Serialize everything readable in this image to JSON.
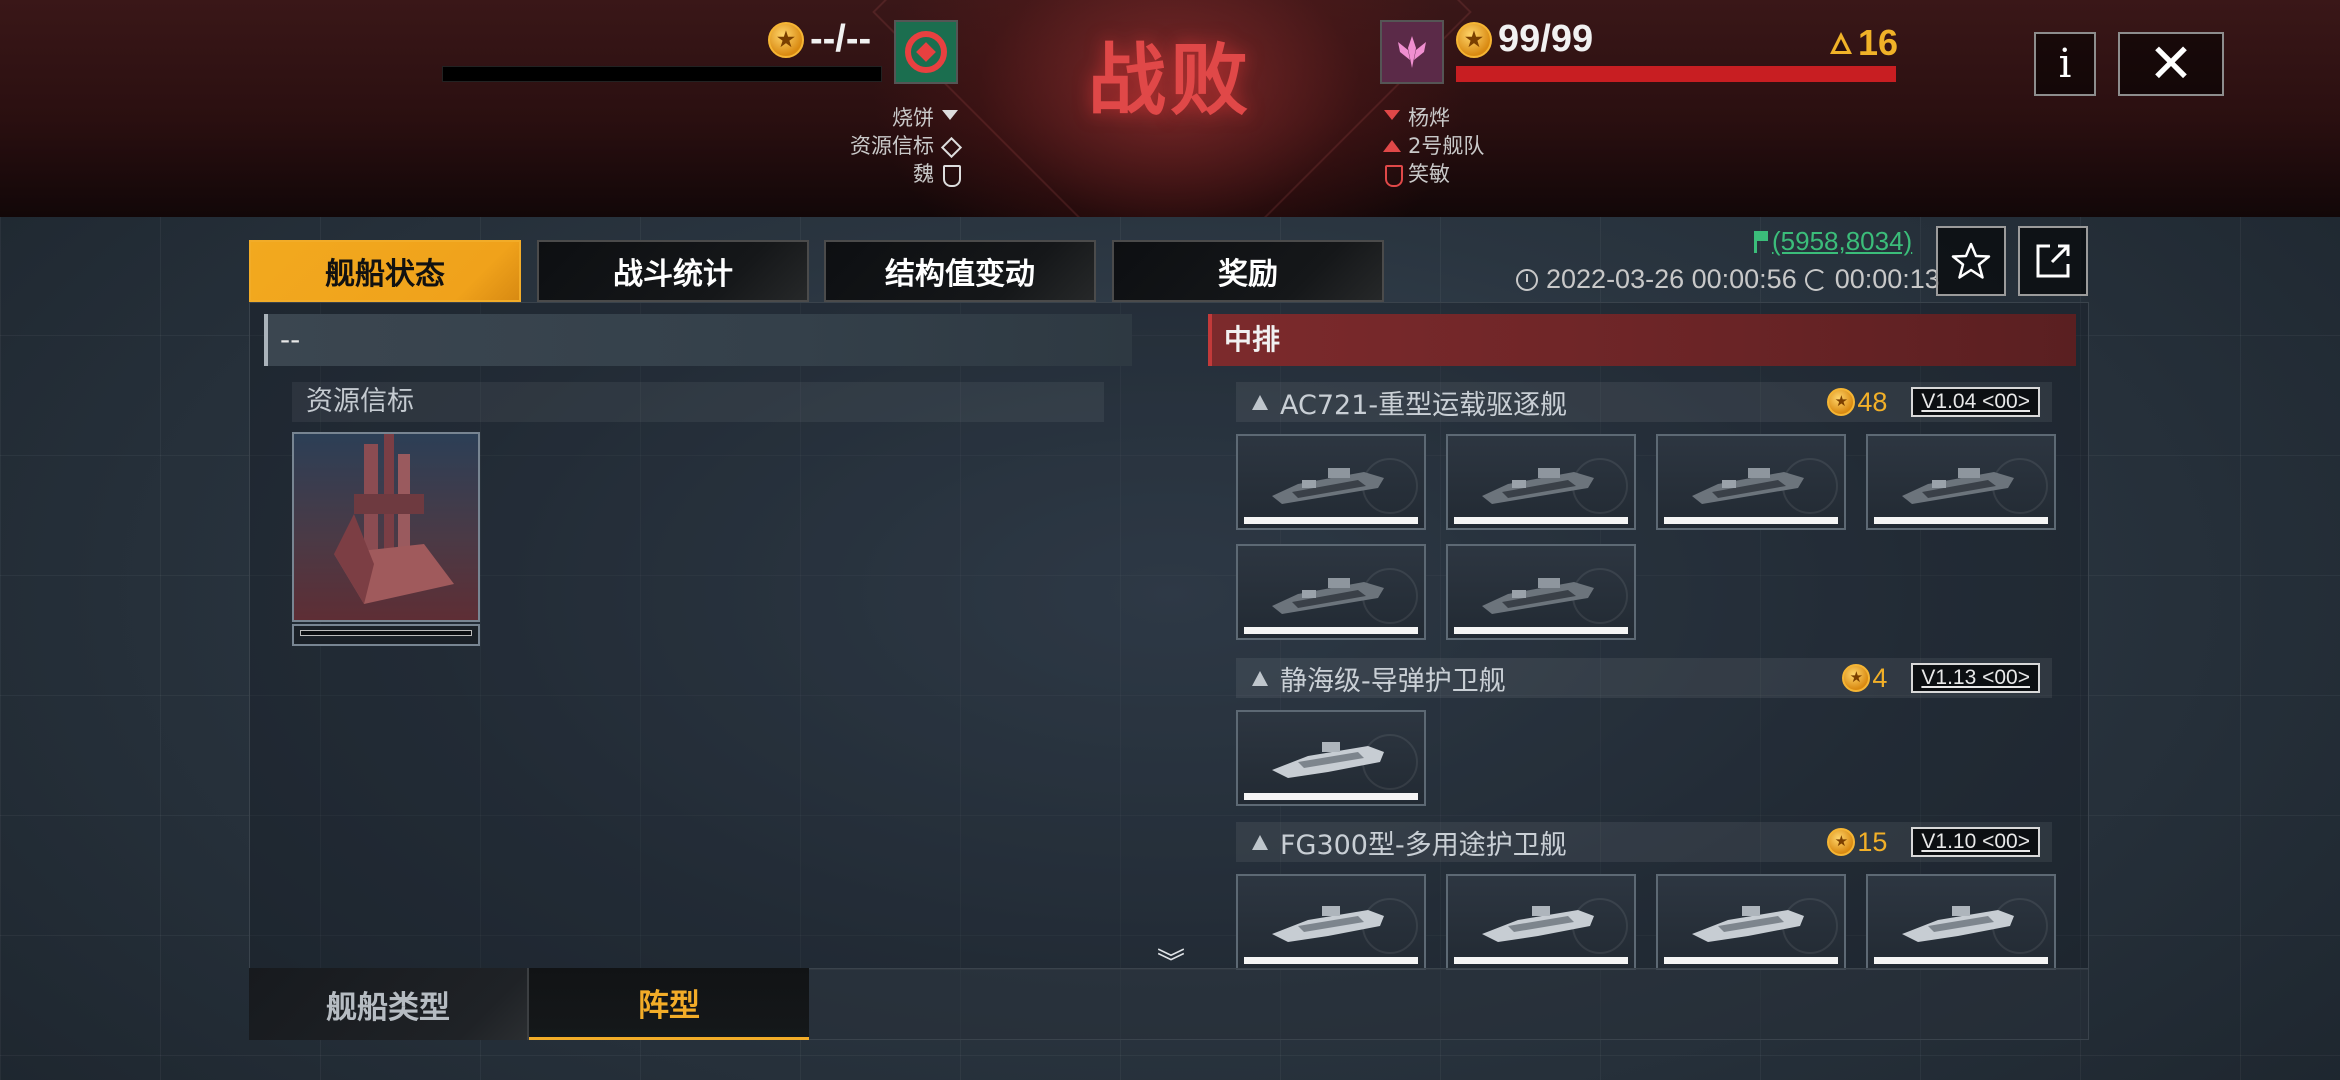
{
  "header": {
    "result_title": "战败",
    "left": {
      "score": "--/--",
      "hp_fraction": 0,
      "info": [
        {
          "text": "烧饼",
          "icon": "commander-down-icon"
        },
        {
          "text": "资源信标",
          "icon": "diamond-icon"
        },
        {
          "text": "魏",
          "icon": "shield-icon"
        }
      ]
    },
    "right": {
      "score": "99/99",
      "hp_fraction": 1,
      "rank": "16",
      "info": [
        {
          "text": "杨烨",
          "icon": "commander-down-red-icon"
        },
        {
          "text": "2号舰队",
          "icon": "fleet-up-red-icon"
        },
        {
          "text": "笑敏",
          "icon": "shield-red-icon"
        }
      ]
    },
    "info_button": "i",
    "close_button": "✕"
  },
  "tabs": [
    "舰船状态",
    "战斗统计",
    "结构值变动",
    "奖励"
  ],
  "active_tab": 0,
  "coordinates": "(5958,8034)",
  "time": {
    "datetime": "2022-03-26 00:00:56",
    "duration": "00:00:13"
  },
  "left_panel": {
    "title": "--",
    "group_name": "资源信标"
  },
  "right_panel": {
    "title": "中排",
    "groups": [
      {
        "name": "AC721-重型运载驱逐舰",
        "count": "48",
        "version": "V1.04 <00>",
        "cards": 6
      },
      {
        "name": "静海级-导弹护卫舰",
        "count": "4",
        "version": "V1.13 <00>",
        "cards": 1
      },
      {
        "name": "FG300型-多用途护卫舰",
        "count": "15",
        "version": "V1.10 <00>",
        "cards": 4
      }
    ]
  },
  "bottom_tabs": [
    "舰船类型",
    "阵型"
  ],
  "active_bottom_tab": 1,
  "colors": {
    "accent": "#f2a91f",
    "defeat_red": "#e04848",
    "hp_red": "#c81e22",
    "coord_green": "#3bbd7a"
  }
}
